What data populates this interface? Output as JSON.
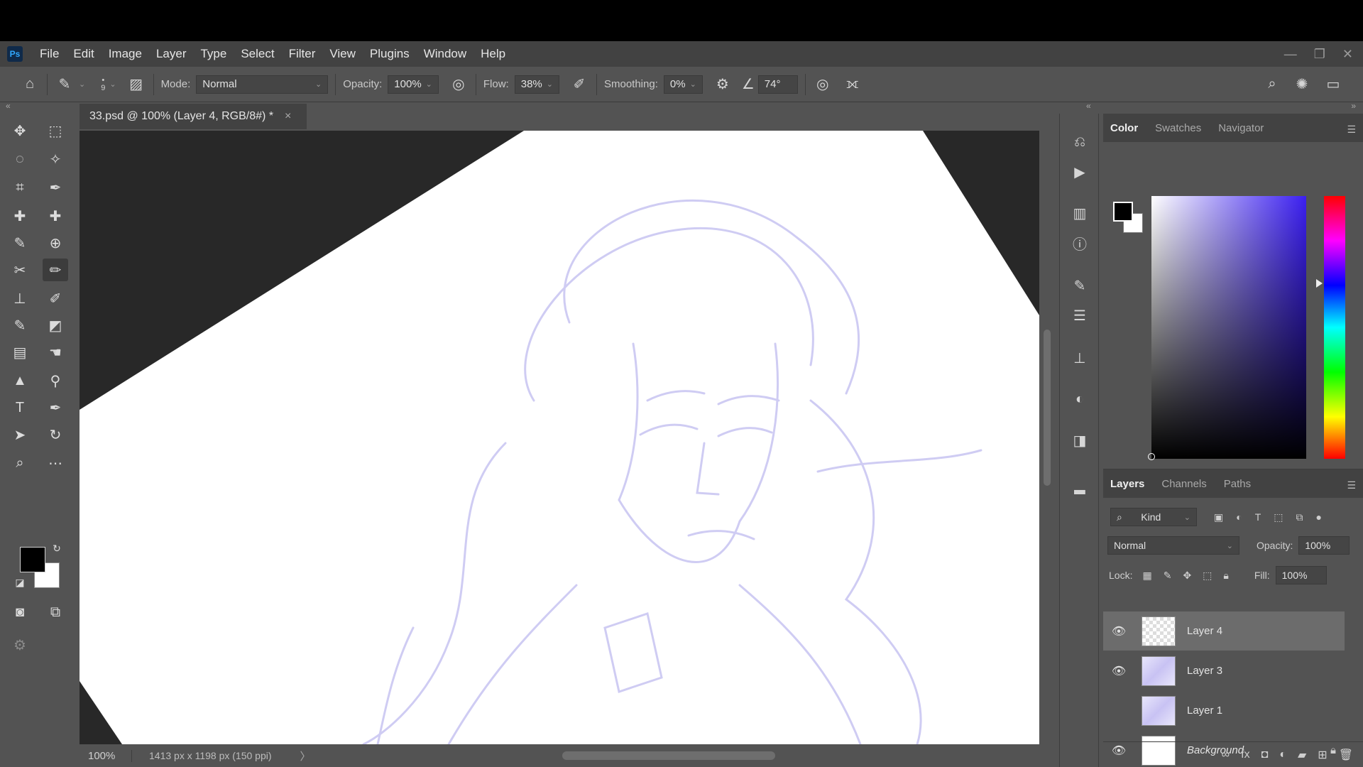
{
  "app": {
    "logo": "Ps"
  },
  "menu": [
    "File",
    "Edit",
    "Image",
    "Layer",
    "Type",
    "Select",
    "Filter",
    "View",
    "Plugins",
    "Window",
    "Help"
  ],
  "window_controls": {
    "minimize": "—",
    "restore": "❐",
    "close": "✕"
  },
  "options": {
    "brush_size": "9",
    "mode_label": "Mode:",
    "mode_value": "Normal",
    "opacity_label": "Opacity:",
    "opacity_value": "100%",
    "flow_label": "Flow:",
    "flow_value": "38%",
    "smoothing_label": "Smoothing:",
    "smoothing_value": "0%",
    "angle_value": "74°"
  },
  "document": {
    "tab_title": "33.psd @ 100% (Layer 4, RGB/8#) *",
    "close": "×"
  },
  "status": {
    "zoom": "100%",
    "doc_info": "1413 px x 1198 px (150 ppi)",
    "arrow": "〉"
  },
  "color_panel": {
    "tabs": [
      "Color",
      "Swatches",
      "Navigator"
    ],
    "active_tab": "Color",
    "foreground": "#000000",
    "background": "#ffffff",
    "hue_color": "#3b1ff0"
  },
  "layers_panel": {
    "tabs": [
      "Layers",
      "Channels",
      "Paths"
    ],
    "filter_kind": "Kind",
    "blend_mode": "Normal",
    "opacity_label": "Opacity:",
    "opacity_value": "100%",
    "lock_label": "Lock:",
    "fill_label": "Fill:",
    "fill_value": "100%",
    "layers": [
      {
        "name": "Layer 4",
        "visible": true,
        "selected": true
      },
      {
        "name": "Layer 3",
        "visible": true,
        "selected": false
      },
      {
        "name": "Layer 1",
        "visible": false,
        "selected": false
      },
      {
        "name": "Background",
        "visible": true,
        "selected": false,
        "locked": true
      }
    ]
  },
  "colors": {
    "sketch_line": "#cfccf3",
    "canvas_bg": "#ffffff",
    "pasteboard": "#282828"
  }
}
